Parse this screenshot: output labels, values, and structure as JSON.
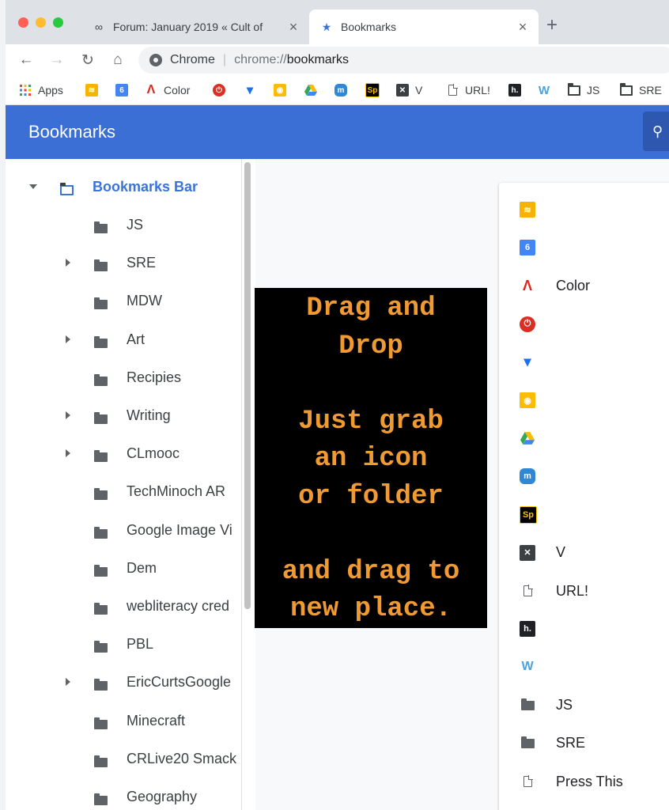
{
  "tabs": [
    {
      "title": "Forum: January 2019 « Cult of",
      "icon": "infinity-icon",
      "active": false
    },
    {
      "title": "Bookmarks",
      "icon": "star-icon",
      "active": true
    }
  ],
  "toolbar": {
    "chip": "Chrome",
    "url_scheme": "chrome://",
    "url_host": "bookmarks"
  },
  "bookmarks_bar": [
    {
      "label": "Apps",
      "icon": "apps-grid-icon"
    },
    {
      "label": "",
      "icon": "feed-icon"
    },
    {
      "label": "6",
      "icon": "calendar-icon"
    },
    {
      "label": "Color",
      "icon": "adobe-icon"
    },
    {
      "label": "",
      "icon": "power-icon"
    },
    {
      "label": "",
      "icon": "vivaldi-icon"
    },
    {
      "label": "",
      "icon": "keep-icon"
    },
    {
      "label": "",
      "icon": "drive-icon"
    },
    {
      "label": "",
      "icon": "mastodon-icon"
    },
    {
      "label": "Sp",
      "icon": "spark-icon"
    },
    {
      "label": "V",
      "icon": "v-icon"
    },
    {
      "label": "URL!",
      "icon": "page-icon"
    },
    {
      "label": "h.",
      "icon": "hypothesis-icon"
    },
    {
      "label": "W",
      "icon": "w-icon"
    },
    {
      "label": "JS",
      "icon": "folder-icon"
    },
    {
      "label": "SRE",
      "icon": "folder-icon"
    }
  ],
  "header": {
    "title": "Bookmarks"
  },
  "tree": {
    "root": "Bookmarks Bar",
    "items": [
      {
        "label": "JS",
        "expandable": false
      },
      {
        "label": "SRE",
        "expandable": true
      },
      {
        "label": "MDW",
        "expandable": false
      },
      {
        "label": "Art",
        "expandable": true
      },
      {
        "label": "Recipies",
        "expandable": false
      },
      {
        "label": "Writing",
        "expandable": true
      },
      {
        "label": "CLmooc",
        "expandable": true
      },
      {
        "label": "TechMinoch AR",
        "expandable": false
      },
      {
        "label": "Google Image Vi",
        "expandable": false
      },
      {
        "label": "Dem",
        "expandable": false
      },
      {
        "label": "webliteracy cred",
        "expandable": false
      },
      {
        "label": "PBL",
        "expandable": false
      },
      {
        "label": "EricCurtsGoogle",
        "expandable": true
      },
      {
        "label": "Minecraft",
        "expandable": false
      },
      {
        "label": "CRLive20 Smack",
        "expandable": false
      },
      {
        "label": "Geography",
        "expandable": false
      }
    ]
  },
  "overlay": {
    "lines": [
      "Drag and",
      "Drop",
      "",
      "Just grab",
      "an icon",
      "or folder",
      "",
      "and drag to",
      "new place."
    ]
  },
  "list": [
    {
      "label": "",
      "icon": "feed-icon"
    },
    {
      "label": "",
      "icon": "calendar-icon",
      "badge": "6"
    },
    {
      "label": "Color",
      "icon": "adobe-icon"
    },
    {
      "label": "",
      "icon": "power-icon"
    },
    {
      "label": "",
      "icon": "vivaldi-icon"
    },
    {
      "label": "",
      "icon": "keep-icon"
    },
    {
      "label": "",
      "icon": "drive-icon"
    },
    {
      "label": "",
      "icon": "mastodon-icon"
    },
    {
      "label": "",
      "icon": "spark-icon",
      "badge": "Sp"
    },
    {
      "label": "V",
      "icon": "v-icon"
    },
    {
      "label": "URL!",
      "icon": "page-icon"
    },
    {
      "label": "",
      "icon": "hypothesis-icon",
      "badge": "h."
    },
    {
      "label": "",
      "icon": "w-icon",
      "badge": "W"
    },
    {
      "label": "JS",
      "icon": "folder-icon"
    },
    {
      "label": "SRE",
      "icon": "folder-icon"
    },
    {
      "label": "Press This",
      "icon": "page-icon"
    }
  ],
  "colors": {
    "accent": "#3b6fd6",
    "overlay_text": "#f09a32"
  }
}
